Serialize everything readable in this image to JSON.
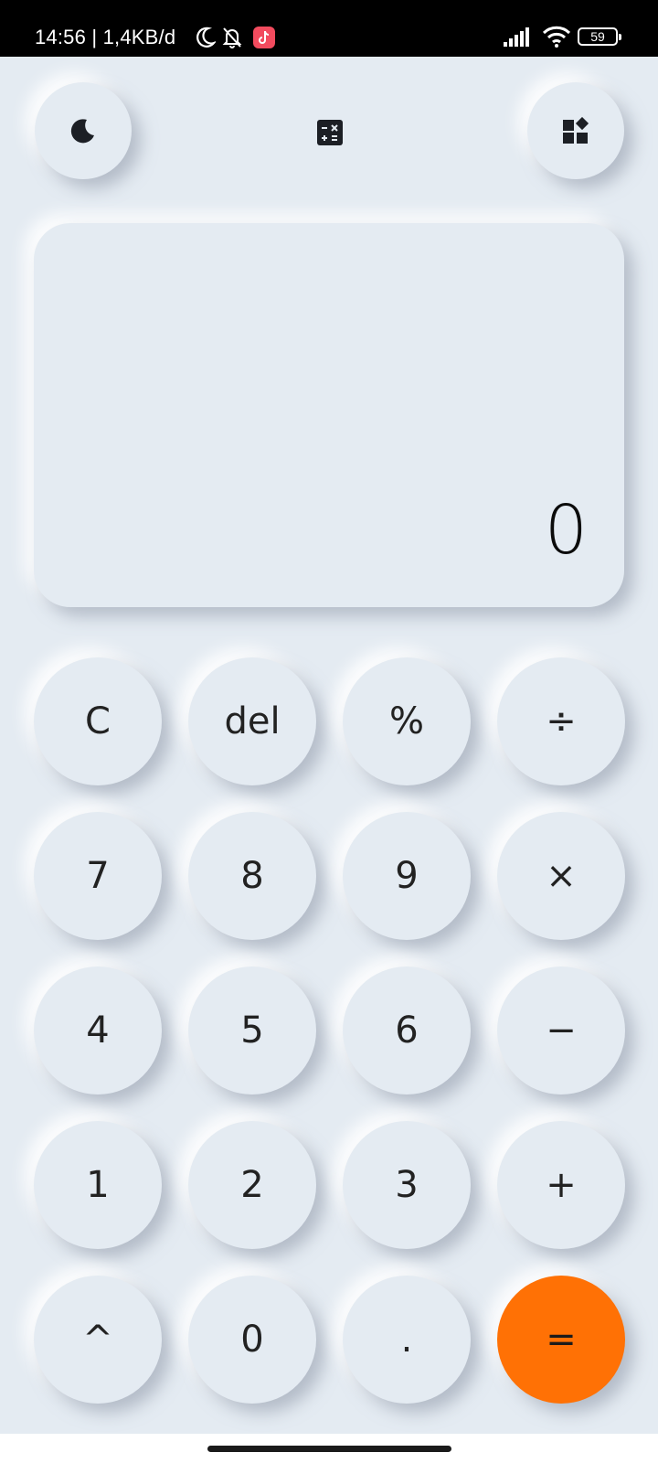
{
  "status_bar": {
    "time_and_speed": "14:56 | 1,4KB/d",
    "battery": "59",
    "icons": [
      "moon-icon",
      "bell-off-icon",
      "tiktok-icon",
      "signal-icon",
      "wifi-icon",
      "battery-icon"
    ]
  },
  "toolbar": {
    "theme_icon": "moon-icon",
    "center_icon": "calculator-icon",
    "right_icon": "widgets-icon"
  },
  "display": {
    "value": "0"
  },
  "keypad": {
    "keys": [
      "C",
      "del",
      "%",
      "÷",
      "7",
      "8",
      "9",
      "×",
      "4",
      "5",
      "6",
      "−",
      "1",
      "2",
      "3",
      "+",
      "^",
      "0",
      ".",
      "="
    ]
  },
  "colors": {
    "background": "#e4ebf2",
    "accent": "#ff7105",
    "text": "#222222"
  }
}
